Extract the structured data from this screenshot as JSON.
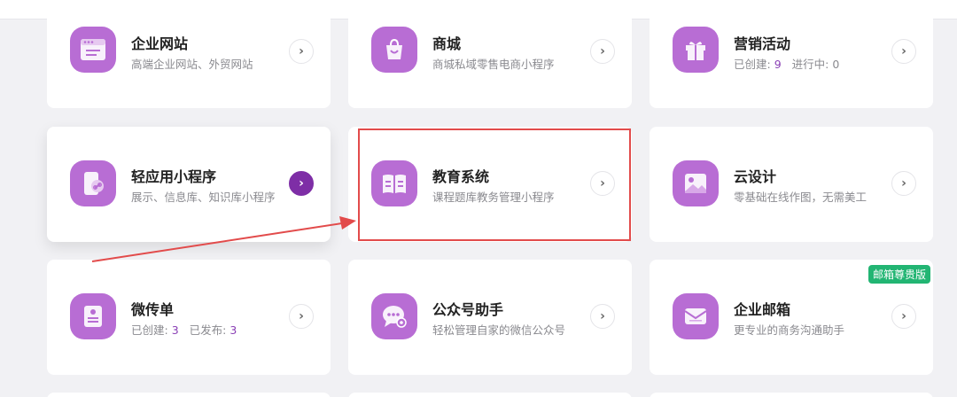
{
  "cards": [
    {
      "id": "website",
      "title": "企业网站",
      "desc": "高端企业网站、外贸网站",
      "icon": "browser-window-icon"
    },
    {
      "id": "mall",
      "title": "商城",
      "desc": "商城私域零售电商小程序",
      "icon": "shopping-bag-icon"
    },
    {
      "id": "marketing",
      "title": "营销活动",
      "desc_parts": {
        "created_label": "已创建:",
        "created_value": "9",
        "running_label": "进行中:",
        "running_value": "0"
      },
      "icon": "gift-icon"
    },
    {
      "id": "lightapp",
      "title": "轻应用小程序",
      "desc": "展示、信息库、知识库小程序",
      "icon": "phone-link-icon"
    },
    {
      "id": "education",
      "title": "教育系统",
      "desc": "课程题库教务管理小程序",
      "icon": "open-book-icon"
    },
    {
      "id": "clouddesign",
      "title": "云设计",
      "desc": "零基础在线作图，无需美工",
      "icon": "image-icon"
    },
    {
      "id": "flyer",
      "title": "微传单",
      "desc_parts": {
        "created_label": "已创建:",
        "created_value": "3",
        "published_label": "已发布:",
        "published_value": "3"
      },
      "icon": "flyer-icon"
    },
    {
      "id": "wechat",
      "title": "公众号助手",
      "desc": "轻松管理自家的微信公众号",
      "icon": "chat-bubble-icon"
    },
    {
      "id": "mail",
      "title": "企业邮箱",
      "desc": "更专业的商务沟通助手",
      "icon": "envelope-icon",
      "badge": "邮箱尊贵版"
    }
  ],
  "arrow_glyph": "›",
  "colors": {
    "accent_purple": "#b86dd4",
    "active_arrow": "#7e2ea6",
    "value_purple": "#8a3fb5",
    "badge_green": "#22b573",
    "annotation_red": "#e24b4b"
  }
}
